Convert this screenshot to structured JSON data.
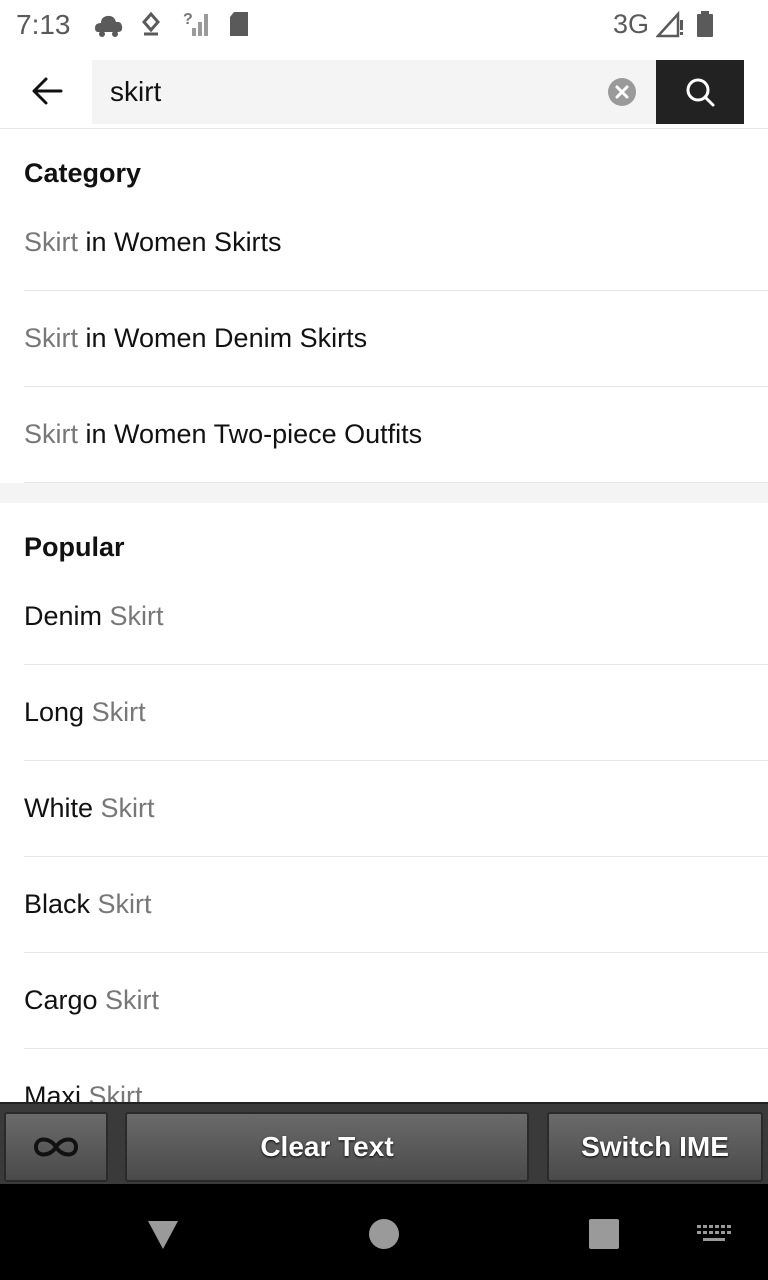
{
  "status_bar": {
    "time": "7:13",
    "network": "3G",
    "icons": [
      "cloud-icon",
      "download-icon",
      "no-signal-icon",
      "sd-card-icon",
      "signal-icon",
      "battery-icon"
    ]
  },
  "search": {
    "query": "skirt",
    "back_icon": "back-arrow-icon",
    "clear_icon": "clear-icon",
    "search_icon": "search-icon"
  },
  "category": {
    "title": "Category",
    "items": [
      {
        "term": "Skirt",
        "rest": " in Women Skirts"
      },
      {
        "term": "Skirt",
        "rest": " in Women Denim Skirts"
      },
      {
        "term": "Skirt",
        "rest": " in Women Two-piece Outfits"
      }
    ]
  },
  "popular": {
    "title": "Popular",
    "items": [
      {
        "prefix": "Denim",
        "term": " Skirt"
      },
      {
        "prefix": "Long",
        "term": " Skirt"
      },
      {
        "prefix": "White",
        "term": " Skirt"
      },
      {
        "prefix": "Black",
        "term": " Skirt"
      },
      {
        "prefix": "Cargo",
        "term": " Skirt"
      },
      {
        "prefix": "Maxi",
        "term": " Skirt"
      }
    ]
  },
  "ime_toolbar": {
    "infinity_icon": "infinity-icon",
    "clear_text_label": "Clear Text",
    "switch_ime_label": "Switch IME"
  },
  "nav_bar": {
    "icons": [
      "back-triangle-icon",
      "home-circle-icon",
      "recents-square-icon",
      "keyboard-icon"
    ]
  },
  "colors": {
    "accent_dark": "#222222",
    "muted_text": "#777777",
    "divider": "#e6e6e6"
  }
}
